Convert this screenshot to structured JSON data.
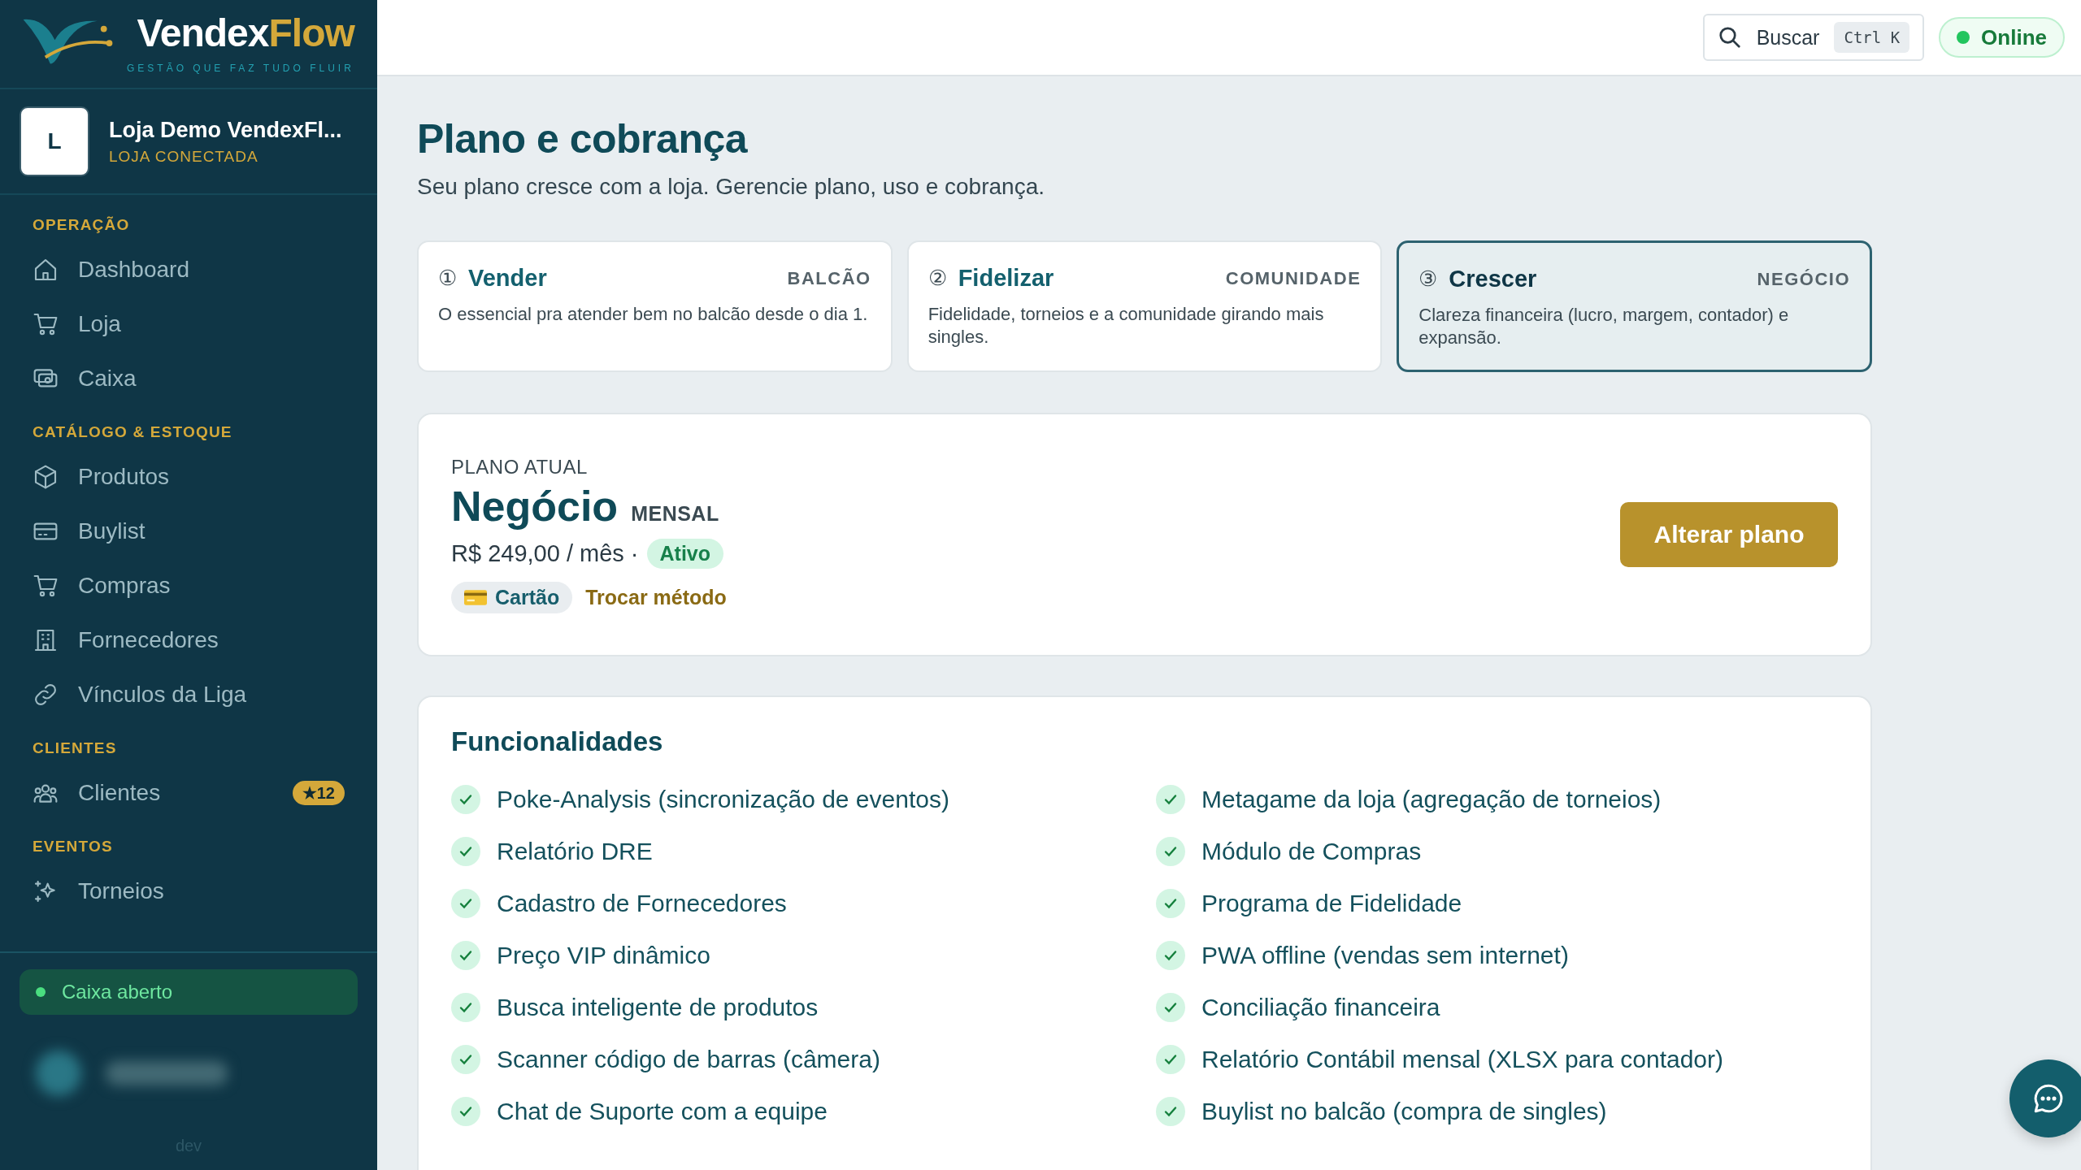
{
  "brand": {
    "name_main": "Vendex",
    "name_accent": "Flow",
    "tagline": "GESTÃO QUE FAZ TUDO FLUIR"
  },
  "store": {
    "initial": "L",
    "name": "Loja Demo VendexFl...",
    "status": "LOJA CONECTADA"
  },
  "sidebar": {
    "sections": [
      {
        "title": "OPERAÇÃO",
        "items": [
          {
            "label": "Dashboard",
            "kind": "home"
          },
          {
            "label": "Loja",
            "kind": "cart"
          },
          {
            "label": "Caixa",
            "kind": "cash"
          }
        ]
      },
      {
        "title": "CATÁLOGO & ESTOQUE",
        "items": [
          {
            "label": "Produtos",
            "kind": "box"
          },
          {
            "label": "Buylist",
            "kind": "card"
          },
          {
            "label": "Compras",
            "kind": "cart"
          },
          {
            "label": "Fornecedores",
            "kind": "building"
          },
          {
            "label": "Vínculos da Liga",
            "kind": "link"
          }
        ]
      },
      {
        "title": "CLIENTES",
        "items": [
          {
            "label": "Clientes",
            "kind": "users",
            "badge": "★12"
          }
        ]
      },
      {
        "title": "EVENTOS",
        "items": [
          {
            "label": "Torneios",
            "kind": "sparkle"
          }
        ]
      }
    ]
  },
  "cash_status": {
    "label": "Caixa aberto",
    "open": true
  },
  "footer_label": "dev",
  "header": {
    "search": {
      "label": "Buscar",
      "shortcut": "Ctrl K"
    },
    "connection": {
      "label": "Online",
      "online": true
    }
  },
  "page": {
    "title": "Plano e cobrança",
    "subtitle": "Seu plano cresce com a loja. Gerencie plano, uso e cobrança."
  },
  "tiers": [
    {
      "number": "①",
      "name": "Vender",
      "tag": "BALCÃO",
      "description": "O essencial pra atender bem no balcão desde o dia 1.",
      "selected": false
    },
    {
      "number": "②",
      "name": "Fidelizar",
      "tag": "COMUNIDADE",
      "description": "Fidelidade, torneios e a comunidade girando mais singles.",
      "selected": false
    },
    {
      "number": "③",
      "name": "Crescer",
      "tag": "NEGÓCIO",
      "description": "Clareza financeira (lucro, margem, contador) e expansão.",
      "selected": true
    }
  ],
  "current_plan": {
    "label": "PLANO ATUAL",
    "name": "Negócio",
    "cycle": "MENSAL",
    "price": "R$ 249,00 / mês ·",
    "status": "Ativo",
    "payment_method": "Cartão",
    "change_method": "Trocar método",
    "action": "Alterar plano"
  },
  "features": {
    "title": "Funcionalidades",
    "items": [
      {
        "label": "Poke-Analysis (sincronização de eventos)",
        "included": true
      },
      {
        "label": "Metagame da loja (agregação de torneios)",
        "included": true
      },
      {
        "label": "Relatório DRE",
        "included": true
      },
      {
        "label": "Módulo de Compras",
        "included": true
      },
      {
        "label": "Cadastro de Fornecedores",
        "included": true
      },
      {
        "label": "Programa de Fidelidade",
        "included": true
      },
      {
        "label": "Preço VIP dinâmico",
        "included": true
      },
      {
        "label": "PWA offline (vendas sem internet)",
        "included": true
      },
      {
        "label": "Busca inteligente de produtos",
        "included": true
      },
      {
        "label": "Conciliação financeira",
        "included": true
      },
      {
        "label": "Scanner código de barras (câmera)",
        "included": true
      },
      {
        "label": "Relatório Contábil mensal (XLSX para contador)",
        "included": true
      },
      {
        "label": "Chat de Suporte com a equipe",
        "included": true
      },
      {
        "label": "Buylist no balcão (compra de singles)",
        "included": true
      }
    ]
  }
}
